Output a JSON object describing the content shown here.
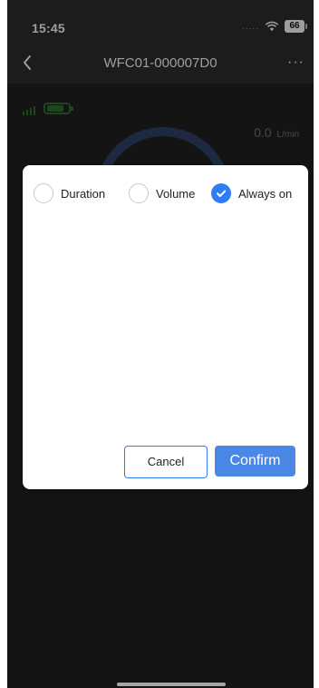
{
  "status_bar": {
    "time": "15:45",
    "signal_dots": ".....",
    "battery_level": "66"
  },
  "nav": {
    "title": "WFC01-000007D0",
    "back_icon": "chevron-left-icon",
    "more_icon": "more-horizontal-icon",
    "more_text": "···"
  },
  "device": {
    "flow_value": "0.0",
    "flow_unit": "L/min",
    "signal_icon": "signal-icon",
    "battery_icon": "battery-icon"
  },
  "dialog": {
    "options": [
      {
        "label": "Duration",
        "selected": false
      },
      {
        "label": "Volume",
        "selected": false
      },
      {
        "label": "Always on",
        "selected": true
      }
    ],
    "buttons": {
      "cancel": "Cancel",
      "confirm": "Confirm"
    }
  },
  "colors": {
    "accent": "#2f7cf6",
    "confirm_bg": "#4b88e6",
    "overlay": "rgba(0,0,0,0.35)",
    "screen_bg": "#1f1f21"
  }
}
